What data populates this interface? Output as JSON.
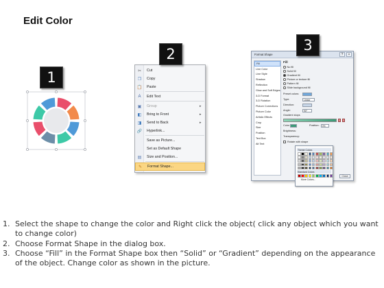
{
  "title": "Edit Color",
  "steps": {
    "one": "1",
    "two": "2",
    "three": "3"
  },
  "ring": {
    "segment_colors": [
      "#e94f6b",
      "#f28a4b",
      "#4f9ad8",
      "#3dc9a7",
      "#6c8ea8",
      "#e94f6b",
      "#3dc9a7",
      "#4f9ad8"
    ]
  },
  "context_menu": {
    "items": [
      {
        "label": "Cut",
        "icon": "scissors-icon"
      },
      {
        "label": "Copy",
        "icon": "copy-icon"
      },
      {
        "label": "Paste",
        "icon": "paste-icon"
      },
      {
        "label": "Edit Text",
        "icon": "edit-text-icon"
      },
      {
        "label": "Group",
        "icon": "group-icon",
        "submenu": true
      },
      {
        "label": "Bring to Front",
        "icon": "bring-front-icon",
        "submenu": true
      },
      {
        "label": "Send to Back",
        "icon": "send-back-icon",
        "submenu": true
      },
      {
        "label": "Hyperlink...",
        "icon": "hyperlink-icon"
      },
      {
        "label": "Save as Picture...",
        "icon": ""
      },
      {
        "label": "Set as Default Shape",
        "icon": ""
      },
      {
        "label": "Size and Position...",
        "icon": "size-icon"
      },
      {
        "label": "Format Shape...",
        "icon": "format-shape-icon"
      }
    ]
  },
  "dialog": {
    "title": "Format Shape",
    "help": "?",
    "close": "×",
    "categories": [
      "Fill",
      "Line Color",
      "Line Style",
      "Shadow",
      "Reflection",
      "Glow and Soft Edges",
      "3-D Format",
      "3-D Rotation",
      "Picture Corrections",
      "Picture Color",
      "Artistic Effects",
      "Crop",
      "Size",
      "Position",
      "Text Box",
      "Alt Text"
    ],
    "fill_heading": "Fill",
    "fill_options": [
      "No fill",
      "Solid fill",
      "Gradient fill",
      "Picture or texture fill",
      "Pattern fill",
      "Slide background fill"
    ],
    "preset_label": "Preset colors:",
    "type_label": "Type:",
    "type_value": "Linear",
    "direction_label": "Direction:",
    "angle_label": "Angle:",
    "angle_value": "90°",
    "stops_label": "Gradient stops",
    "color_label": "Color",
    "position_label": "Position:",
    "position_value": "0%",
    "brightness_label": "Brightness:",
    "transparency_label": "Transparency:",
    "rotate_label": "Rotate with shape",
    "close_button": "Close"
  },
  "palette": {
    "theme_label": "Theme Colors",
    "standard_label": "Standard Colors",
    "more_label": "More Colors...",
    "theme_colors": [
      "#ffffff",
      "#000000",
      "#eeece1",
      "#1f497d",
      "#4f81bd",
      "#c0504d",
      "#9bbb59",
      "#8064a2",
      "#4bacc6",
      "#f79646",
      "#f2f2f2",
      "#7f7f7f",
      "#ddd9c3",
      "#c6d9f0",
      "#dbe5f1",
      "#f2dcdb",
      "#ebf1dd",
      "#e5e0ec",
      "#dbeef3",
      "#fdeada",
      "#d8d8d8",
      "#595959",
      "#c4bd97",
      "#8db3e2",
      "#b8cce4",
      "#e5b9b7",
      "#d7e3bc",
      "#ccc1d9",
      "#b7dde8",
      "#fbd5b5",
      "#bfbfbf",
      "#3f3f3f",
      "#938953",
      "#548dd4",
      "#95b3d7",
      "#d99694",
      "#c3d69b",
      "#b2a2c7",
      "#92cddc",
      "#fac08f",
      "#a5a5a5",
      "#262626",
      "#494429",
      "#17365d",
      "#366092",
      "#953734",
      "#76923c",
      "#5f497a",
      "#31859b",
      "#e36c09"
    ],
    "standard_colors": [
      "#c00000",
      "#ff0000",
      "#ffc000",
      "#ffff00",
      "#92d050",
      "#00b050",
      "#00b0f0",
      "#0070c0",
      "#002060",
      "#7030a0"
    ]
  },
  "instructions": [
    {
      "num": "1.",
      "text": "Select the shape to change the color and Right click the object( click any object which you want to change color)"
    },
    {
      "num": "2.",
      "text": "Choose Format Shape in the dialog box."
    },
    {
      "num": "3.",
      "text": "Choose “Fill” in the Format Shape box then “Solid” or “Gradient” depending on the appearance of the object. Change color as shown in the picture."
    }
  ]
}
